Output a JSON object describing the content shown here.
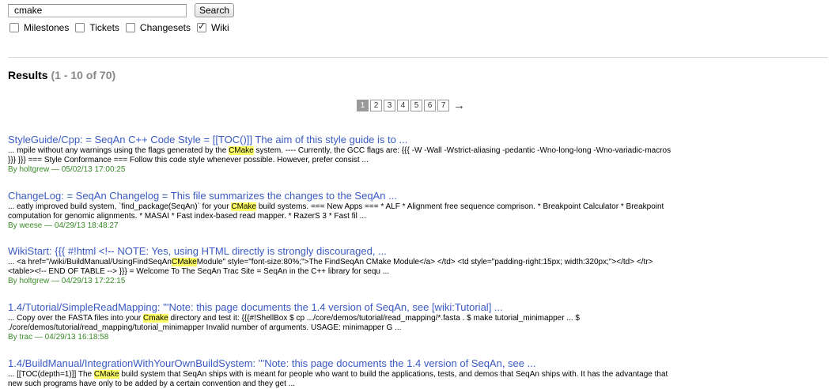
{
  "search": {
    "query": "cmake",
    "button_label": "Search"
  },
  "filters": [
    {
      "label": "Milestones",
      "checked": false
    },
    {
      "label": "Tickets",
      "checked": false
    },
    {
      "label": "Changesets",
      "checked": false
    },
    {
      "label": "Wiki",
      "checked": true
    }
  ],
  "results_heading": {
    "title": "Results",
    "count": "(1 - 10 of 70)"
  },
  "pagination": {
    "pages": [
      "1",
      "2",
      "3",
      "4",
      "5",
      "6",
      "7"
    ],
    "current": "1",
    "next": "→"
  },
  "results": [
    {
      "title": "StyleGuide/Cpp: = SeqAn C++ Code Style = [[TOC()]] The aim of this style guide is to ...",
      "excerpt": [
        {
          "t": "... mpile without any warnings using the flags generated by the "
        },
        {
          "t": "CMake",
          "hl": true
        },
        {
          "t": " system. ---- Currently, the GCC flags are: {{{ -W -Wall -Wstrict-aliasing -pedantic -Wno-long-long -Wno-variadic-macros\n}}} }}} === Style Conformance === Follow this code style whenever possible. However, prefer consist ..."
        }
      ],
      "meta": "By holtgrew — 05/02/13 17:00:25"
    },
    {
      "title": "ChangeLog: = SeqAn Changelog = This file summarizes the changes to the SeqAn ...",
      "excerpt": [
        {
          "t": "... eatly improved build system, `find_package(SeqAn)` for your "
        },
        {
          "t": "CMake",
          "hl": true
        },
        {
          "t": " build systems. === New Apps === * ALF * Alignment free sequence comprison. * Breakpoint Calculator * Breakpoint\ncomputation for genomic alignments. * MASAI * Fast index-based read mapper. * RazerS 3 * Fast fil ..."
        }
      ],
      "meta": "By weese — 04/29/13 18:48:27"
    },
    {
      "title": "WikiStart: {{{ #!html <!-- NOTE: Yes, using HTML directly is strongly discouraged, ...",
      "excerpt": [
        {
          "t": "... <a href=\"/wiki/BuildManual/UsingFindSeqAn"
        },
        {
          "t": "CMake",
          "hl": true
        },
        {
          "t": "Module\" style=\"font-size:80%;\">The FindSeqAn CMake Module</a> </td> <td style=\"padding-right:15px; width:320px;\"></td> </tr>\n<table><!-- END OF TABLE --> }}} = Welcome To The SeqAn Trac Site = SeqAn in the C++ library for sequ ..."
        }
      ],
      "meta": "By holtgrew — 04/29/13 17:22:15"
    },
    {
      "title": "1.4/Tutorial/SimpleReadMapping: '''Note: this page documents the 1.4 version of SeqAn, see [wiki:Tutorial] ...",
      "excerpt": [
        {
          "t": "... Copy over the FASTA files into your "
        },
        {
          "t": "Cmake",
          "hl": true
        },
        {
          "t": " directory and test it: {{{#!ShellBox $ cp .../core/demos/tutorial/read_mapping/*.fasta . $ make tutorial_minimapper ... $\n./core/demos/tutorial/read_mapping/tutorial_minimapper Invalid number of arguments. USAGE: minimapper G ..."
        }
      ],
      "meta": "By trac — 04/29/13 16:18:58"
    },
    {
      "title": "1.4/BuildManual/IntegrationWithYourOwnBuildSystem: '''Note: this page documents the 1.4 version of SeqAn, see ...",
      "excerpt": [
        {
          "t": "... [[TOC(depth=1)]] The "
        },
        {
          "t": "CMake",
          "hl": true
        },
        {
          "t": " build system that SeqAn ships with is meant for people who want to build the applications, tests, and demos that SeqAn ships with. It has the advantage that\nnew such programs have only to be added by a certain convention and they get ..."
        }
      ],
      "meta": ""
    }
  ]
}
